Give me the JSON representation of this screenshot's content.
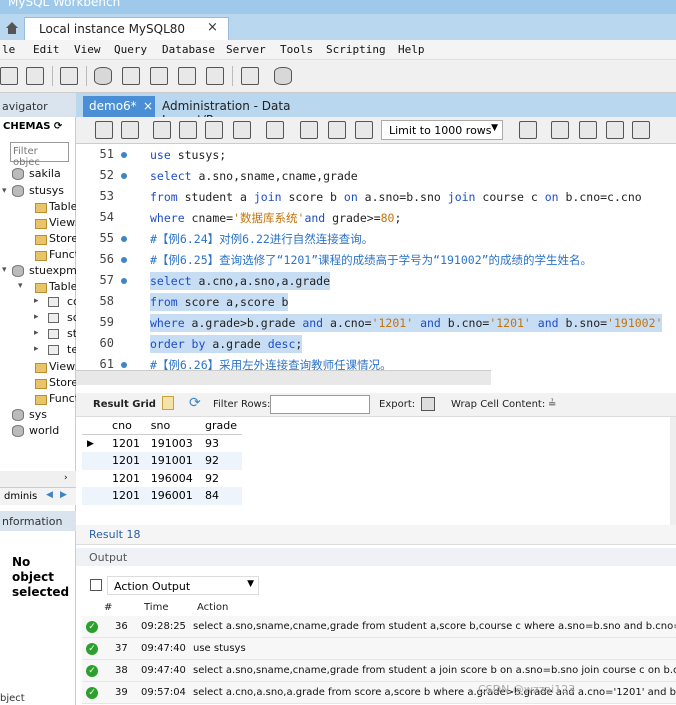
{
  "window": {
    "title": "MySQL Workbench",
    "connection_tab": "Local instance MySQL80",
    "close": "×"
  },
  "menu": [
    "le",
    "Edit",
    "View",
    "Query",
    "Database",
    "Server",
    "Tools",
    "Scripting",
    "Help"
  ],
  "navigator": {
    "title": "avigator",
    "schemas_label": "CHEMAS",
    "filter_placeholder": "Filter objec",
    "tree": [
      {
        "label": "sakila",
        "kind": "db",
        "depth": 0
      },
      {
        "label": "stusys",
        "kind": "db",
        "depth": 0
      },
      {
        "label": "Table",
        "kind": "folder",
        "depth": 1
      },
      {
        "label": "Views",
        "kind": "folder",
        "depth": 1
      },
      {
        "label": "Store",
        "kind": "folder",
        "depth": 1
      },
      {
        "label": "Funct",
        "kind": "folder",
        "depth": 1
      },
      {
        "label": "stuexpm",
        "kind": "db",
        "depth": 0
      },
      {
        "label": "Table",
        "kind": "folder",
        "depth": 1
      },
      {
        "label": "cc",
        "kind": "table",
        "depth": 2
      },
      {
        "label": "sc",
        "kind": "table",
        "depth": 2
      },
      {
        "label": "st",
        "kind": "table",
        "depth": 2
      },
      {
        "label": "te",
        "kind": "table",
        "depth": 2
      },
      {
        "label": "Views",
        "kind": "folder",
        "depth": 1
      },
      {
        "label": "Store",
        "kind": "folder",
        "depth": 1
      },
      {
        "label": "Funct",
        "kind": "folder",
        "depth": 1
      },
      {
        "label": "sys",
        "kind": "db",
        "depth": 0
      },
      {
        "label": "world",
        "kind": "db",
        "depth": 0
      }
    ],
    "subtab": "dminis",
    "info_title": "nformation",
    "no_object": "No object selected",
    "bottom_label": "bject"
  },
  "editor": {
    "tabs": [
      {
        "label": "demo6*",
        "active": true
      },
      {
        "label": "Administration - Data Import/Res..."
      }
    ],
    "limit_label": "Limit to 1000 rows",
    "lines": [
      {
        "n": "51",
        "dot": true,
        "sel": false,
        "tokens": [
          [
            "kw",
            "use"
          ],
          [
            "",
            " stusys;"
          ]
        ]
      },
      {
        "n": "52",
        "dot": true,
        "sel": false,
        "tokens": [
          [
            "kw",
            "select"
          ],
          [
            "",
            " a.sno,sname,cname,grade"
          ]
        ]
      },
      {
        "n": "53",
        "dot": false,
        "sel": false,
        "tokens": [
          [
            "kw",
            "from"
          ],
          [
            "",
            " student a "
          ],
          [
            "kw",
            "join"
          ],
          [
            "",
            " score b "
          ],
          [
            "kw",
            "on"
          ],
          [
            "",
            " a.sno=b.sno "
          ],
          [
            "kw",
            "join"
          ],
          [
            "",
            " course c "
          ],
          [
            "kw",
            "on"
          ],
          [
            "",
            " b.cno=c.cno"
          ]
        ]
      },
      {
        "n": "54",
        "dot": false,
        "sel": false,
        "tokens": [
          [
            "kw",
            "where"
          ],
          [
            "",
            " cname="
          ],
          [
            "str",
            "'数据库系统'"
          ],
          [
            "kw",
            "and"
          ],
          [
            "",
            " grade>="
          ],
          [
            "num",
            "80"
          ],
          [
            "",
            ";"
          ]
        ]
      },
      {
        "n": "55",
        "dot": true,
        "sel": false,
        "tokens": [
          [
            "cmt",
            "#【例6.24】对例6.22进行自然连接查询。"
          ]
        ]
      },
      {
        "n": "56",
        "dot": true,
        "sel": false,
        "tokens": [
          [
            "cmt",
            "#【例6.25】查询选修了“1201”课程的成绩高于学号为“191002”的成绩的学生姓名。"
          ]
        ]
      },
      {
        "n": "57",
        "dot": true,
        "sel": true,
        "tokens": [
          [
            "kw",
            "select"
          ],
          [
            "",
            " a.cno,a.sno,a.grade"
          ]
        ]
      },
      {
        "n": "58",
        "dot": false,
        "sel": true,
        "tokens": [
          [
            "kw",
            "from"
          ],
          [
            "",
            " score a,score b"
          ]
        ]
      },
      {
        "n": "59",
        "dot": false,
        "sel": true,
        "tokens": [
          [
            "kw",
            "where"
          ],
          [
            "",
            " a.grade>b.grade "
          ],
          [
            "kw",
            "and"
          ],
          [
            "",
            " a.cno="
          ],
          [
            "str",
            "'1201'"
          ],
          [
            "",
            " "
          ],
          [
            "kw",
            "and"
          ],
          [
            "",
            " b.cno="
          ],
          [
            "str",
            "'1201'"
          ],
          [
            "",
            " "
          ],
          [
            "kw",
            "and"
          ],
          [
            "",
            " b.sno="
          ],
          [
            "str",
            "'191002'"
          ]
        ]
      },
      {
        "n": "60",
        "dot": false,
        "sel": true,
        "tokens": [
          [
            "kw",
            "order by"
          ],
          [
            "",
            " a.grade "
          ],
          [
            "kw",
            "desc"
          ],
          [
            "",
            ";"
          ]
        ]
      },
      {
        "n": "61",
        "dot": true,
        "sel": false,
        "tokens": [
          [
            "cmt",
            "#【例6.26】采用左外连接查询教师任课情况。"
          ]
        ]
      }
    ]
  },
  "results": {
    "grid_label": "Result Grid",
    "filter_label": "Filter Rows:",
    "export_label": "Export:",
    "wrap_label": "Wrap Cell Content:",
    "columns": [
      "cno",
      "sno",
      "grade"
    ],
    "rows": [
      [
        "1201",
        "191003",
        "93"
      ],
      [
        "1201",
        "191001",
        "92"
      ],
      [
        "1201",
        "196004",
        "92"
      ],
      [
        "1201",
        "196001",
        "84"
      ]
    ],
    "tab_label": "Result 18"
  },
  "output": {
    "title": "Output",
    "select_label": "Action Output",
    "headers": {
      "num": "#",
      "time": "Time",
      "action": "Action"
    },
    "rows": [
      {
        "num": "36",
        "time": "09:28:25",
        "action": "select a.sno,sname,cname,grade from student a,score b,course c where a.sno=b.sno and b.cno=c.cn"
      },
      {
        "num": "37",
        "time": "09:47:40",
        "action": "use stusys"
      },
      {
        "num": "38",
        "time": "09:47:40",
        "action": "select a.sno,sname,cname,grade from student a join score b on a.sno=b.sno join course c on b.cno=c."
      },
      {
        "num": "39",
        "time": "09:57:04",
        "action": "select a.cno,a.sno,a.grade from score a,score b where a.grade>b.grade and a.cno='1201' and b.cno='1"
      }
    ]
  },
  "watermark": "CSDN @wzzai123"
}
